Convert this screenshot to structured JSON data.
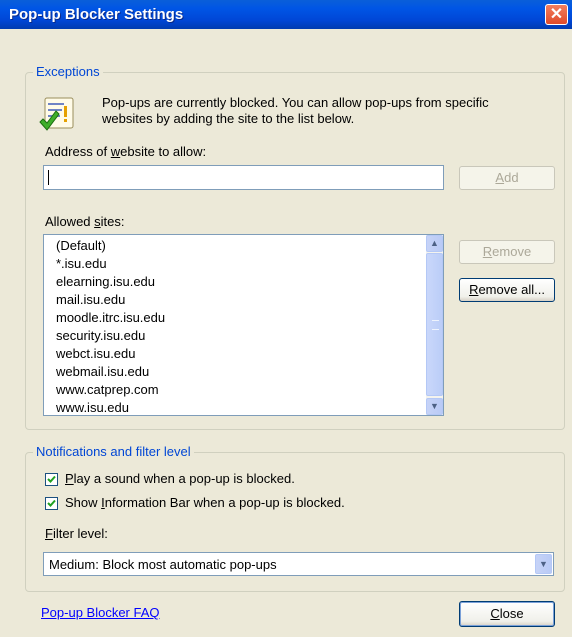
{
  "window": {
    "title": "Pop-up Blocker Settings",
    "close_glyph": "✕"
  },
  "exceptions": {
    "legend": "Exceptions",
    "info_line1": "Pop-ups are currently blocked.  You can allow pop-ups from specific",
    "info_line2": "websites by adding the site to the list below.",
    "address_label_pre": "Address of ",
    "address_label_key": "w",
    "address_label_post": "ebsite to allow:",
    "address_value": "",
    "add_key": "A",
    "add_rest": "dd",
    "allowed_label_pre": "Allowed ",
    "allowed_label_key": "s",
    "allowed_label_post": "ites:",
    "sites": [
      "(Default)",
      "*.isu.edu",
      "elearning.isu.edu",
      "mail.isu.edu",
      "moodle.itrc.isu.edu",
      "security.isu.edu",
      "webct.isu.edu",
      "webmail.isu.edu",
      "www.catprep.com",
      "www.isu.edu"
    ],
    "remove_key": "R",
    "remove_rest": "emove",
    "remove_all_key": "R",
    "remove_all_rest": "emove all..."
  },
  "notifications": {
    "legend": "Notifications and filter level",
    "play_sound_key": "P",
    "play_sound_rest": "lay a sound when a pop-up is blocked.",
    "play_sound_checked": true,
    "info_bar_pre": "Show ",
    "info_bar_key": "I",
    "info_bar_post": "nformation Bar when a pop-up is blocked.",
    "info_bar_checked": true,
    "filter_key": "F",
    "filter_rest": "ilter level:",
    "filter_value": "Medium: Block most automatic pop-ups"
  },
  "footer": {
    "faq_link": "Pop-up Blocker FAQ",
    "close_key": "C",
    "close_rest": "lose"
  },
  "icons": {
    "title_close": "close-icon",
    "info": "checklist-icon",
    "scroll_up": "chevron-up-icon",
    "scroll_down": "chevron-down-icon",
    "dropdown": "chevron-down-icon"
  }
}
